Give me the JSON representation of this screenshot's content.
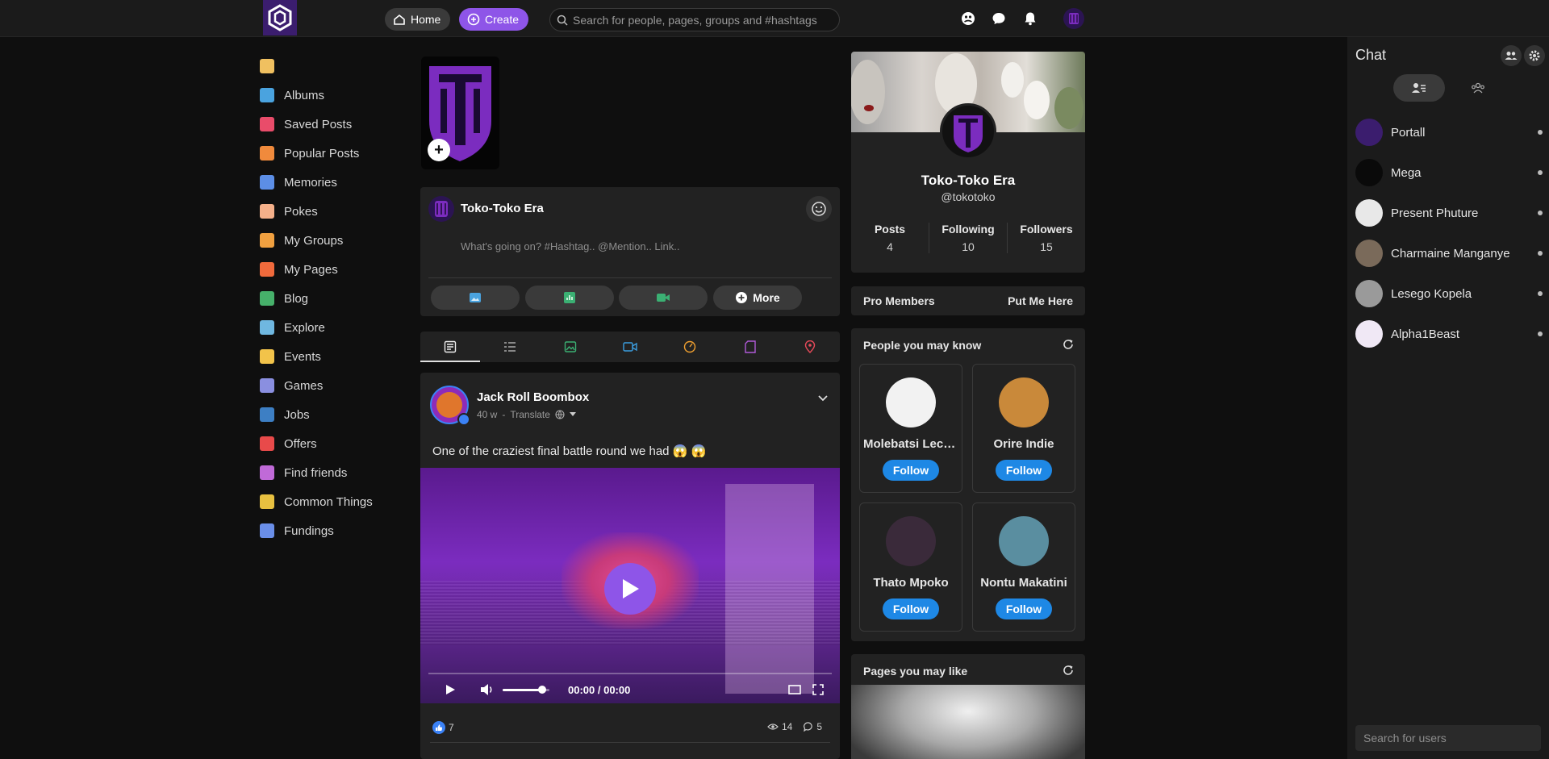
{
  "header": {
    "home_label": "Home",
    "create_label": "Create",
    "search_placeholder": "Search for people, pages, groups and #hashtags"
  },
  "colors": {
    "accent": "#8e55e8",
    "follow_button": "#1e88e5",
    "background": "#0f0f0f",
    "card": "#222222"
  },
  "sidebar": {
    "items": [
      {
        "label": "",
        "icon": "home-icon",
        "color": "#f0c060"
      },
      {
        "label": "Albums",
        "icon": "albums-icon",
        "color": "#4aa3df"
      },
      {
        "label": "Saved Posts",
        "icon": "bookmark-icon",
        "color": "#e94c6a"
      },
      {
        "label": "Popular Posts",
        "icon": "popular-icon",
        "color": "#f08a3c"
      },
      {
        "label": "Memories",
        "icon": "memories-icon",
        "color": "#5c8ee6"
      },
      {
        "label": "Pokes",
        "icon": "poke-icon",
        "color": "#f5b08a"
      },
      {
        "label": "My Groups",
        "icon": "groups-icon",
        "color": "#f0a040"
      },
      {
        "label": "My Pages",
        "icon": "pages-icon",
        "color": "#f06a3c"
      },
      {
        "label": "Blog",
        "icon": "blog-icon",
        "color": "#46b06a"
      },
      {
        "label": "Explore",
        "icon": "explore-icon",
        "color": "#6fb7e0"
      },
      {
        "label": "Events",
        "icon": "events-icon",
        "color": "#f2c34a"
      },
      {
        "label": "Games",
        "icon": "games-icon",
        "color": "#8a8fe0"
      },
      {
        "label": "Jobs",
        "icon": "jobs-icon",
        "color": "#3d7fc4"
      },
      {
        "label": "Offers",
        "icon": "offers-icon",
        "color": "#e84a4a"
      },
      {
        "label": "Find friends",
        "icon": "find-friends-icon",
        "color": "#c06ad8"
      },
      {
        "label": "Common Things",
        "icon": "common-things-icon",
        "color": "#e8c040"
      },
      {
        "label": "Fundings",
        "icon": "fundings-icon",
        "color": "#6a8ee8"
      }
    ]
  },
  "composer": {
    "user_name": "Toko-Toko Era",
    "placeholder": "What's going on? #Hashtag.. @Mention.. Link..",
    "more_label": "More"
  },
  "post": {
    "author": "Jack Roll Boombox",
    "time": "40 w",
    "translate": "Translate",
    "text": "One of the craziest final battle round we had 😱 😱",
    "video_time": "00:00 / 00:00",
    "video_volume": 0.85,
    "likes": "7",
    "views": "14",
    "comments": "5"
  },
  "profile": {
    "name": "Toko-Toko Era",
    "handle": "@tokotoko",
    "stats": [
      {
        "label": "Posts",
        "value": "4"
      },
      {
        "label": "Following",
        "value": "10"
      },
      {
        "label": "Followers",
        "value": "15"
      }
    ]
  },
  "pro_members": {
    "title": "Pro Members",
    "action": "Put Me Here"
  },
  "people_you_may_know": {
    "title": "People you may know",
    "follow_label": "Follow",
    "people": [
      {
        "name": "Molebatsi Lech...",
        "color": "#f2f2f2"
      },
      {
        "name": "Orire Indie",
        "color": "#c9893a"
      },
      {
        "name": "Thato Mpoko",
        "color": "#3a2a3a"
      },
      {
        "name": "Nontu Makatini",
        "color": "#5a8ea0"
      }
    ]
  },
  "pages_you_may_like": {
    "title": "Pages you may like"
  },
  "chat": {
    "title": "Chat",
    "search_placeholder": "Search for users",
    "contacts": [
      {
        "name": "Portall",
        "color": "#3b1d6e"
      },
      {
        "name": "Mega",
        "color": "#0a0a0a"
      },
      {
        "name": "Present Phuture",
        "color": "#e8e8e8"
      },
      {
        "name": "Charmaine Manganye",
        "color": "#7a6a5a"
      },
      {
        "name": "Lesego Kopela",
        "color": "#9a9a9a"
      },
      {
        "name": "Alpha1Beast",
        "color": "#f0e8f5"
      }
    ]
  }
}
